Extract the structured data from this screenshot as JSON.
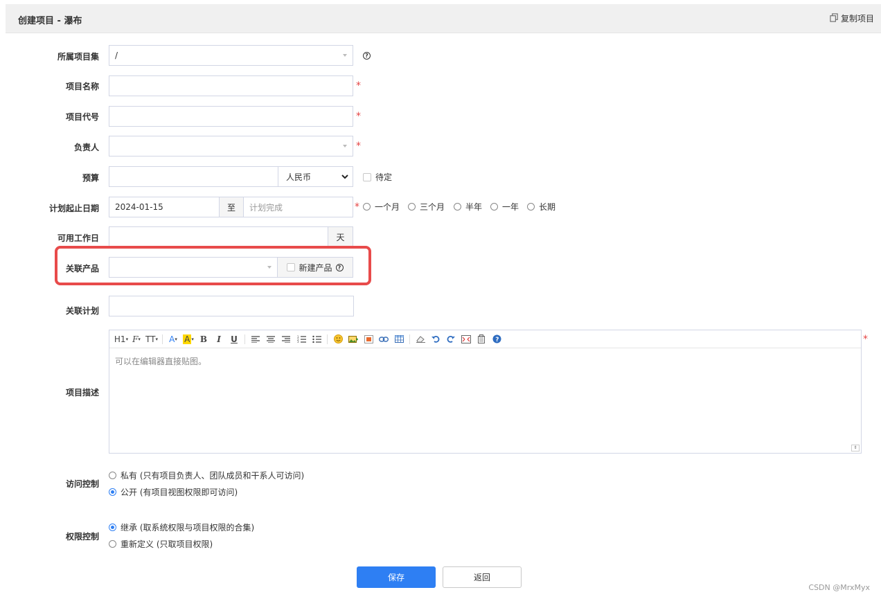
{
  "header": {
    "title": "创建项目 - 瀑布",
    "copy_label": "复制项目"
  },
  "form": {
    "project_set": {
      "label": "所属项目集",
      "value": "/"
    },
    "project_name": {
      "label": "项目名称",
      "value": ""
    },
    "project_code": {
      "label": "项目代号",
      "value": ""
    },
    "owner": {
      "label": "负责人",
      "value": ""
    },
    "budget": {
      "label": "预算",
      "value": "",
      "currency": "人民币",
      "pending_label": "待定"
    },
    "plan_dates": {
      "label": "计划起止日期",
      "start": "2024-01-15",
      "to": "至",
      "end_placeholder": "计划完成",
      "options": [
        "一个月",
        "三个月",
        "半年",
        "一年",
        "长期"
      ]
    },
    "workdays": {
      "label": "可用工作日",
      "value": "",
      "unit": "天"
    },
    "linked_product": {
      "label": "关联产品",
      "value": "",
      "new_product_label": "新建产品"
    },
    "linked_plan": {
      "label": "关联计划",
      "value": ""
    },
    "description": {
      "label": "项目描述",
      "placeholder": "可以在编辑器直接贴图。",
      "toolbar": [
        "H1",
        "F",
        "TT",
        "A",
        "A",
        "B",
        "I",
        "U"
      ]
    },
    "access": {
      "label": "访问控制",
      "options": [
        {
          "text": "私有 (只有项目负责人、团队成员和干系人可访问)",
          "checked": false
        },
        {
          "text": "公开 (有项目视图权限即可访问)",
          "checked": true
        }
      ]
    },
    "permission": {
      "label": "权限控制",
      "options": [
        {
          "text": "继承 (取系统权限与项目权限的合集)",
          "checked": true
        },
        {
          "text": "重新定义 (只取项目权限)",
          "checked": false
        }
      ]
    }
  },
  "buttons": {
    "save": "保存",
    "back": "返回"
  },
  "required_mark": "*",
  "watermark": "CSDN @MrxMyx",
  "colors": {
    "primary": "#2e7ff3",
    "required": "#e54545",
    "highlight": "#e84b4b"
  }
}
